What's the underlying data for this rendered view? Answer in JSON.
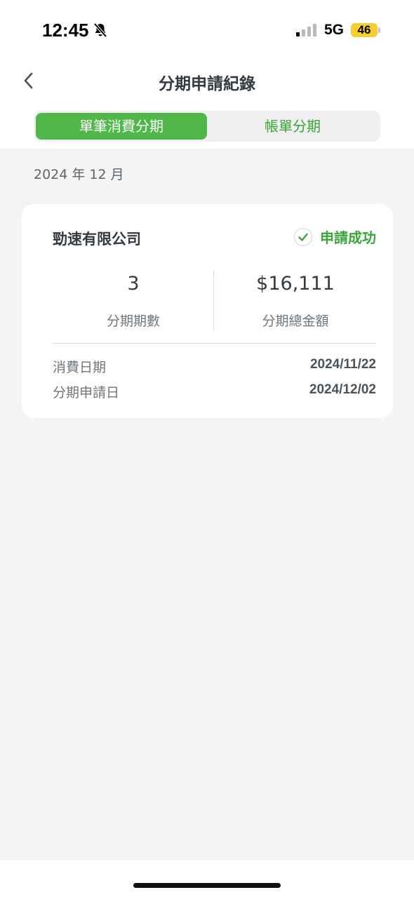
{
  "status_bar": {
    "time": "12:45",
    "network": "5G",
    "battery": "46"
  },
  "nav": {
    "title": "分期申請紀錄"
  },
  "tabs": [
    {
      "label": "單筆消費分期",
      "active": true
    },
    {
      "label": "帳單分期",
      "active": false
    }
  ],
  "month": "2024 年 12 月",
  "record": {
    "merchant": "勁速有限公司",
    "status": "申請成功",
    "installments_value": "3",
    "installments_label": "分期期數",
    "amount_value": "$16,111",
    "amount_label": "分期總金額",
    "details": [
      {
        "label": "消費日期",
        "value": "2024/11/22"
      },
      {
        "label": "分期申請日",
        "value": "2024/12/02"
      }
    ]
  },
  "colors": {
    "accent": "#4fb848",
    "success_text": "#3aa53a",
    "background": "#f4f4f4"
  }
}
